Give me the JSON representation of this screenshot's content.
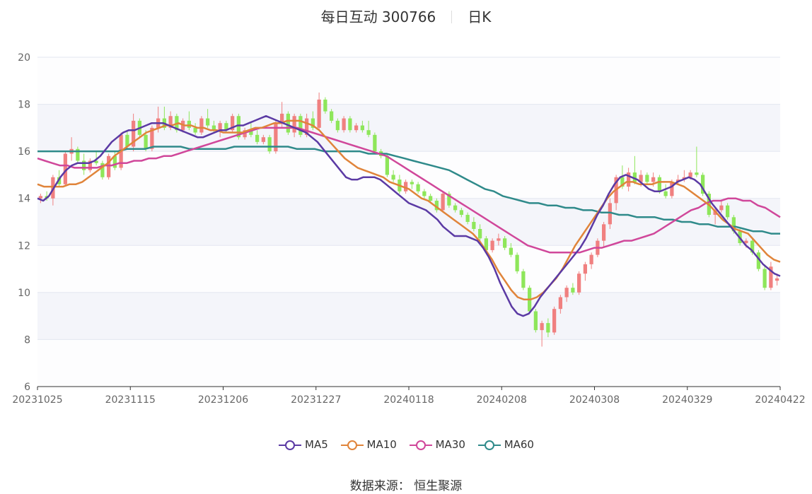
{
  "header": {
    "title": "每日互动 300766",
    "period": "日K"
  },
  "legend": {
    "items": [
      {
        "label": "MA5",
        "color": "#5b3aa4"
      },
      {
        "label": "MA10",
        "color": "#e0843a"
      },
      {
        "label": "MA30",
        "color": "#d0479a"
      },
      {
        "label": "MA60",
        "color": "#2f8a8a"
      }
    ]
  },
  "source_text": "数据来源： 恒生聚源",
  "colors": {
    "up": "#f08080",
    "down": "#8ee65a",
    "band": "#f4f5fa",
    "grid": "#e3e6f0"
  },
  "chart_data": {
    "type": "candlestick",
    "title": "每日互动 300766 日K",
    "y_ticks": [
      "6",
      "8",
      "10",
      "12",
      "14",
      "16",
      "18",
      "20"
    ],
    "ylim": [
      6,
      20
    ],
    "x_ticks": [
      "20231025",
      "20231115",
      "20231206",
      "20231227",
      "20240118",
      "20240208",
      "20240308",
      "20240329",
      "20240422"
    ],
    "trading_days": 120,
    "ohlc": [
      [
        14.0,
        14.2,
        13.8,
        14.1
      ],
      [
        14.1,
        14.3,
        13.9,
        14.0
      ],
      [
        14.0,
        15.0,
        13.7,
        14.9
      ],
      [
        14.9,
        15.2,
        14.5,
        14.6
      ],
      [
        14.6,
        16.0,
        14.5,
        15.9
      ],
      [
        15.9,
        16.6,
        15.6,
        16.1
      ],
      [
        16.1,
        16.2,
        15.5,
        15.6
      ],
      [
        15.6,
        15.9,
        15.0,
        15.2
      ],
      [
        15.2,
        15.7,
        15.1,
        15.6
      ],
      [
        15.6,
        16.0,
        15.4,
        15.5
      ],
      [
        15.5,
        15.6,
        14.8,
        14.9
      ],
      [
        14.9,
        15.9,
        14.8,
        15.8
      ],
      [
        15.8,
        16.0,
        15.2,
        15.3
      ],
      [
        15.3,
        16.8,
        15.2,
        16.7
      ],
      [
        16.7,
        16.9,
        16.1,
        16.2
      ],
      [
        16.2,
        17.6,
        16.0,
        17.3
      ],
      [
        17.3,
        17.4,
        16.6,
        16.7
      ],
      [
        16.7,
        16.9,
        16.0,
        16.1
      ],
      [
        16.1,
        17.1,
        16.0,
        17.0
      ],
      [
        17.0,
        17.9,
        16.8,
        17.4
      ],
      [
        17.4,
        17.9,
        16.9,
        17.0
      ],
      [
        17.0,
        17.7,
        16.9,
        17.5
      ],
      [
        17.5,
        17.6,
        16.8,
        16.9
      ],
      [
        16.9,
        17.4,
        16.8,
        17.3
      ],
      [
        17.3,
        17.7,
        16.9,
        17.0
      ],
      [
        17.0,
        17.2,
        16.7,
        16.8
      ],
      [
        16.8,
        17.5,
        16.7,
        17.4
      ],
      [
        17.4,
        17.8,
        17.0,
        17.1
      ],
      [
        17.1,
        17.3,
        16.8,
        16.9
      ],
      [
        16.9,
        17.3,
        16.6,
        17.2
      ],
      [
        17.2,
        17.3,
        16.8,
        16.9
      ],
      [
        16.9,
        17.6,
        16.8,
        17.5
      ],
      [
        17.5,
        17.6,
        16.5,
        16.6
      ],
      [
        16.6,
        17.0,
        16.5,
        16.9
      ],
      [
        16.9,
        17.2,
        16.6,
        16.7
      ],
      [
        16.7,
        16.9,
        16.3,
        16.4
      ],
      [
        16.4,
        16.7,
        16.3,
        16.6
      ],
      [
        16.6,
        16.7,
        15.9,
        16.0
      ],
      [
        16.0,
        17.3,
        15.9,
        17.2
      ],
      [
        17.2,
        18.1,
        17.0,
        17.6
      ],
      [
        17.6,
        17.7,
        16.7,
        16.8
      ],
      [
        16.8,
        17.6,
        16.6,
        17.5
      ],
      [
        17.5,
        17.6,
        16.6,
        16.7
      ],
      [
        16.7,
        17.6,
        16.6,
        17.4
      ],
      [
        17.4,
        17.7,
        16.9,
        17.0
      ],
      [
        17.0,
        18.5,
        16.9,
        18.2
      ],
      [
        18.2,
        18.3,
        17.6,
        17.7
      ],
      [
        17.7,
        17.8,
        17.2,
        17.3
      ],
      [
        17.3,
        17.4,
        16.8,
        16.9
      ],
      [
        16.9,
        17.5,
        16.8,
        17.4
      ],
      [
        17.4,
        17.5,
        16.8,
        16.9
      ],
      [
        16.9,
        17.2,
        16.8,
        17.1
      ],
      [
        17.1,
        17.3,
        16.8,
        16.9
      ],
      [
        16.9,
        17.3,
        16.6,
        16.7
      ],
      [
        16.7,
        16.8,
        15.9,
        16.0
      ],
      [
        16.0,
        16.1,
        15.7,
        15.8
      ],
      [
        15.8,
        15.9,
        14.9,
        15.0
      ],
      [
        15.0,
        15.2,
        14.7,
        14.8
      ],
      [
        14.8,
        15.0,
        14.2,
        14.3
      ],
      [
        14.3,
        14.8,
        14.2,
        14.7
      ],
      [
        14.7,
        14.8,
        14.4,
        14.6
      ],
      [
        14.6,
        14.7,
        14.2,
        14.3
      ],
      [
        14.3,
        14.4,
        14.0,
        14.1
      ],
      [
        14.1,
        14.2,
        13.8,
        13.9
      ],
      [
        13.9,
        14.0,
        13.4,
        13.5
      ],
      [
        13.5,
        14.3,
        13.4,
        14.2
      ],
      [
        14.2,
        14.3,
        13.6,
        13.7
      ],
      [
        13.7,
        13.8,
        13.4,
        13.5
      ],
      [
        13.5,
        13.6,
        13.2,
        13.3
      ],
      [
        13.3,
        13.4,
        12.9,
        13.0
      ],
      [
        13.0,
        13.2,
        12.6,
        12.7
      ],
      [
        12.7,
        12.9,
        12.2,
        12.3
      ],
      [
        12.3,
        12.4,
        11.7,
        11.8
      ],
      [
        11.8,
        12.3,
        11.7,
        12.2
      ],
      [
        12.2,
        12.5,
        12.0,
        12.3
      ],
      [
        12.3,
        12.4,
        11.8,
        11.9
      ],
      [
        11.9,
        12.1,
        11.5,
        11.6
      ],
      [
        11.6,
        11.7,
        10.8,
        10.9
      ],
      [
        10.9,
        11.0,
        10.1,
        10.2
      ],
      [
        10.2,
        10.3,
        9.1,
        9.2
      ],
      [
        9.2,
        9.3,
        8.3,
        8.4
      ],
      [
        8.4,
        8.8,
        7.7,
        8.7
      ],
      [
        8.7,
        8.9,
        8.1,
        8.3
      ],
      [
        8.3,
        9.4,
        8.2,
        9.3
      ],
      [
        9.3,
        9.9,
        9.1,
        9.8
      ],
      [
        9.8,
        10.3,
        9.6,
        10.2
      ],
      [
        10.2,
        10.4,
        9.9,
        10.0
      ],
      [
        10.0,
        10.9,
        9.9,
        10.8
      ],
      [
        10.8,
        11.3,
        10.5,
        11.2
      ],
      [
        11.2,
        11.7,
        11.0,
        11.6
      ],
      [
        11.6,
        12.3,
        11.5,
        12.2
      ],
      [
        12.2,
        13.0,
        11.9,
        12.9
      ],
      [
        12.9,
        14.0,
        12.7,
        13.8
      ],
      [
        13.8,
        15.0,
        13.5,
        14.9
      ],
      [
        14.9,
        15.4,
        14.4,
        14.5
      ],
      [
        14.5,
        15.3,
        14.3,
        15.1
      ],
      [
        15.1,
        15.8,
        14.6,
        14.7
      ],
      [
        14.7,
        15.2,
        14.5,
        15.0
      ],
      [
        15.0,
        15.1,
        14.6,
        14.7
      ],
      [
        14.7,
        15.1,
        14.5,
        14.9
      ],
      [
        14.9,
        15.0,
        14.2,
        14.3
      ],
      [
        14.3,
        14.6,
        14.0,
        14.1
      ],
      [
        14.1,
        14.8,
        14.0,
        14.7
      ],
      [
        14.7,
        15.0,
        14.6,
        14.8
      ],
      [
        14.8,
        15.2,
        14.7,
        14.9
      ],
      [
        14.9,
        15.2,
        14.8,
        15.1
      ],
      [
        15.1,
        16.2,
        14.9,
        15.0
      ],
      [
        15.0,
        15.1,
        14.1,
        14.2
      ],
      [
        14.2,
        14.3,
        13.2,
        13.3
      ],
      [
        13.3,
        13.6,
        12.9,
        13.5
      ],
      [
        13.5,
        13.9,
        13.4,
        13.7
      ],
      [
        13.7,
        13.8,
        13.1,
        13.2
      ],
      [
        13.2,
        13.3,
        12.5,
        12.6
      ],
      [
        12.6,
        12.7,
        12.0,
        12.1
      ],
      [
        12.1,
        12.3,
        11.9,
        12.2
      ],
      [
        12.2,
        12.3,
        11.6,
        11.7
      ],
      [
        11.7,
        11.8,
        10.9,
        11.0
      ],
      [
        11.0,
        11.2,
        10.1,
        10.2
      ],
      [
        10.2,
        11.3,
        10.1,
        11.1
      ],
      [
        10.5,
        10.8,
        10.3,
        10.6
      ]
    ],
    "ma5": [
      14.0,
      13.9,
      14.1,
      14.5,
      14.9,
      15.2,
      15.4,
      15.5,
      15.5,
      15.5,
      15.6,
      15.8,
      16.1,
      16.4,
      16.6,
      16.8,
      16.9,
      16.9,
      17.0,
      17.1,
      17.2,
      17.2,
      17.2,
      17.1,
      17.0,
      16.9,
      16.8,
      16.7,
      16.6,
      16.6,
      16.7,
      16.8,
      16.9,
      16.9,
      17.0,
      17.1,
      17.1,
      17.2,
      17.3,
      17.4,
      17.5,
      17.4,
      17.3,
      17.2,
      17.1,
      17.0,
      16.9,
      16.8,
      16.6,
      16.4,
      16.1,
      15.8,
      15.5,
      15.2,
      14.9,
      14.8,
      14.8,
      14.9,
      14.9,
      14.9,
      14.8,
      14.6,
      14.4,
      14.2,
      14.0,
      13.8,
      13.7,
      13.6,
      13.5,
      13.3,
      13.1,
      12.8,
      12.6,
      12.4,
      12.4,
      12.4,
      12.3,
      12.2,
      11.9,
      11.5,
      11.0,
      10.4,
      9.9,
      9.4,
      9.1,
      9.0,
      9.1,
      9.4,
      9.8,
      10.1,
      10.4,
      10.7,
      11.0,
      11.3,
      11.6,
      11.9,
      12.3,
      12.8,
      13.3,
      13.7,
      14.2,
      14.6,
      14.9,
      15.0,
      14.9,
      14.8,
      14.6,
      14.4,
      14.3,
      14.3,
      14.4,
      14.5,
      14.7,
      14.8,
      14.9,
      14.8,
      14.6,
      14.2,
      13.8,
      13.5,
      13.2,
      12.9,
      12.6,
      12.3,
      12.0,
      11.8,
      11.5,
      11.2,
      11.0,
      10.8,
      10.7
    ],
    "ma10": [
      14.6,
      14.5,
      14.5,
      14.5,
      14.5,
      14.6,
      14.6,
      14.7,
      14.9,
      15.1,
      15.3,
      15.5,
      15.8,
      16.0,
      16.2,
      16.4,
      16.6,
      16.8,
      16.9,
      17.0,
      17.1,
      17.1,
      17.2,
      17.1,
      17.1,
      17.0,
      17.0,
      16.9,
      16.9,
      16.8,
      16.8,
      16.8,
      16.8,
      16.9,
      17.0,
      17.0,
      17.1,
      17.2,
      17.2,
      17.3,
      17.3,
      17.3,
      17.2,
      17.1,
      16.9,
      16.6,
      16.3,
      16.0,
      15.7,
      15.5,
      15.3,
      15.2,
      15.1,
      15.0,
      14.9,
      14.7,
      14.6,
      14.5,
      14.4,
      14.2,
      14.0,
      13.9,
      13.7,
      13.5,
      13.3,
      13.1,
      12.9,
      12.7,
      12.5,
      12.2,
      11.8,
      11.4,
      10.9,
      10.5,
      10.1,
      9.8,
      9.7,
      9.7,
      9.8,
      10.0,
      10.3,
      10.6,
      11.0,
      11.5,
      12.0,
      12.4,
      12.8,
      13.2,
      13.6,
      14.0,
      14.3,
      14.5,
      14.7,
      14.7,
      14.6,
      14.6,
      14.6,
      14.7,
      14.7,
      14.7,
      14.6,
      14.5,
      14.3,
      14.1,
      13.9,
      13.7,
      13.4,
      13.1,
      12.9,
      12.7,
      12.6,
      12.5,
      12.2,
      11.9,
      11.6,
      11.4,
      11.3
    ],
    "ma30": [
      15.7,
      15.6,
      15.5,
      15.4,
      15.4,
      15.3,
      15.3,
      15.3,
      15.3,
      15.4,
      15.4,
      15.5,
      15.5,
      15.6,
      15.6,
      15.7,
      15.7,
      15.8,
      15.8,
      15.9,
      16.0,
      16.1,
      16.2,
      16.3,
      16.4,
      16.5,
      16.6,
      16.7,
      16.8,
      16.9,
      17.0,
      17.0,
      17.0,
      17.0,
      17.0,
      17.0,
      16.9,
      16.8,
      16.7,
      16.6,
      16.5,
      16.4,
      16.3,
      16.2,
      16.1,
      16.0,
      15.9,
      15.8,
      15.6,
      15.4,
      15.2,
      15.0,
      14.8,
      14.6,
      14.4,
      14.2,
      14.0,
      13.8,
      13.6,
      13.4,
      13.2,
      13.0,
      12.8,
      12.6,
      12.4,
      12.2,
      12.0,
      11.9,
      11.8,
      11.7,
      11.7,
      11.7,
      11.7,
      11.7,
      11.8,
      11.9,
      11.9,
      12.0,
      12.1,
      12.2,
      12.2,
      12.3,
      12.4,
      12.5,
      12.7,
      12.9,
      13.1,
      13.3,
      13.5,
      13.6,
      13.8,
      13.9,
      13.9,
      14.0,
      14.0,
      13.9,
      13.9,
      13.7,
      13.6,
      13.4,
      13.2
    ],
    "ma60": [
      16.0,
      16.0,
      16.0,
      16.0,
      16.0,
      16.0,
      16.0,
      16.0,
      16.0,
      16.0,
      16.1,
      16.1,
      16.1,
      16.2,
      16.2,
      16.2,
      16.2,
      16.1,
      16.1,
      16.1,
      16.1,
      16.1,
      16.2,
      16.2,
      16.2,
      16.2,
      16.2,
      16.2,
      16.2,
      16.1,
      16.1,
      16.1,
      16.0,
      16.0,
      16.0,
      16.0,
      16.0,
      15.9,
      15.9,
      15.9,
      15.8,
      15.7,
      15.6,
      15.5,
      15.4,
      15.3,
      15.2,
      15.0,
      14.8,
      14.6,
      14.4,
      14.3,
      14.1,
      14.0,
      13.9,
      13.8,
      13.8,
      13.7,
      13.7,
      13.6,
      13.6,
      13.5,
      13.5,
      13.4,
      13.4,
      13.3,
      13.3,
      13.2,
      13.2,
      13.2,
      13.1,
      13.1,
      13.0,
      13.0,
      12.9,
      12.9,
      12.8,
      12.8,
      12.8,
      12.7,
      12.6,
      12.6,
      12.5,
      12.5
    ]
  }
}
